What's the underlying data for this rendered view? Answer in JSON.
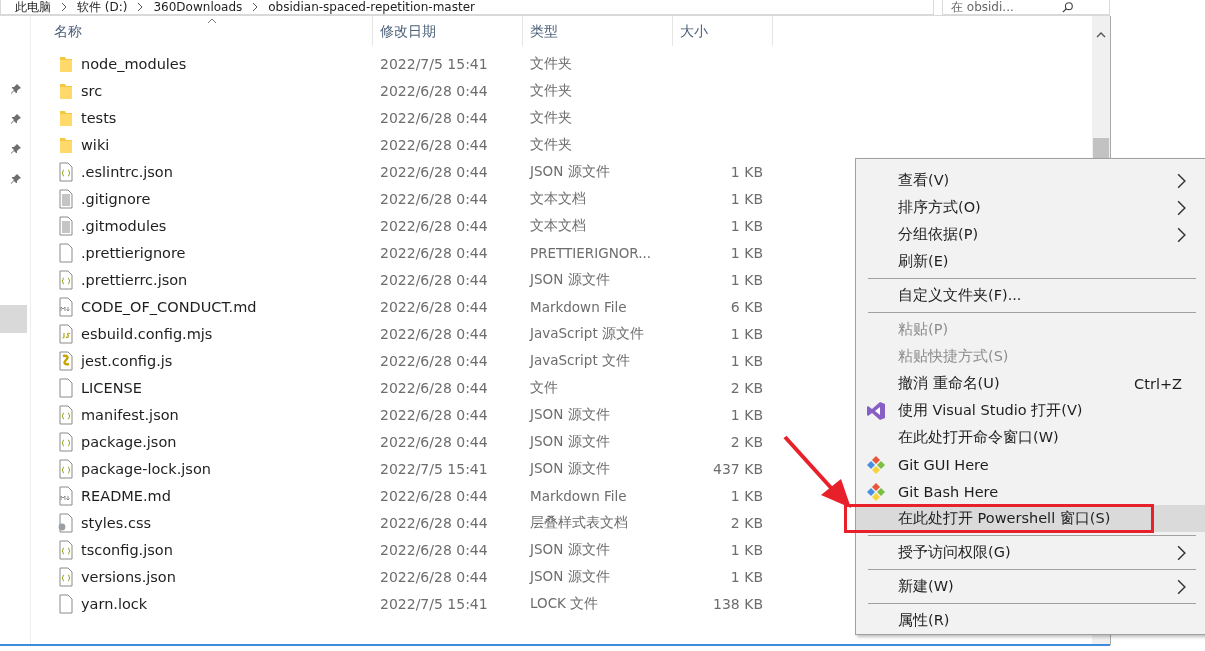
{
  "address": {
    "crumbs": [
      "此电脑",
      "软件 (D:)",
      "360Downloads",
      "obsidian-spaced-repetition-master"
    ]
  },
  "search": {
    "placeholder": "在 obsidi..."
  },
  "columns": [
    {
      "label": "名称",
      "sorted": true
    },
    {
      "label": "修改日期",
      "sorted": false
    },
    {
      "label": "类型",
      "sorted": false
    },
    {
      "label": "大小",
      "sorted": false
    }
  ],
  "rows": [
    {
      "kind": "folder",
      "name": "node_modules",
      "date": "2022/7/5 15:41",
      "type": "文件夹",
      "size": ""
    },
    {
      "kind": "folder",
      "name": "src",
      "date": "2022/6/28 0:44",
      "type": "文件夹",
      "size": ""
    },
    {
      "kind": "folder",
      "name": "tests",
      "date": "2022/6/28 0:44",
      "type": "文件夹",
      "size": ""
    },
    {
      "kind": "folder",
      "name": "wiki",
      "date": "2022/6/28 0:44",
      "type": "文件夹",
      "size": ""
    },
    {
      "kind": "json",
      "name": ".eslintrc.json",
      "date": "2022/6/28 0:44",
      "type": "JSON 源文件",
      "size": "1 KB"
    },
    {
      "kind": "text",
      "name": ".gitignore",
      "date": "2022/6/28 0:44",
      "type": "文本文档",
      "size": "1 KB"
    },
    {
      "kind": "text",
      "name": ".gitmodules",
      "date": "2022/6/28 0:44",
      "type": "文本文档",
      "size": "1 KB"
    },
    {
      "kind": "blank",
      "name": ".prettierignore",
      "date": "2022/6/28 0:44",
      "type": "PRETTIERIGNOR...",
      "size": "1 KB"
    },
    {
      "kind": "json",
      "name": ".prettierrc.json",
      "date": "2022/6/28 0:44",
      "type": "JSON 源文件",
      "size": "1 KB"
    },
    {
      "kind": "md",
      "name": "CODE_OF_CONDUCT.md",
      "date": "2022/6/28 0:44",
      "type": "Markdown File",
      "size": "6 KB"
    },
    {
      "kind": "js",
      "name": "esbuild.config.mjs",
      "date": "2022/6/28 0:44",
      "type": "JavaScript 源文件",
      "size": "1 KB"
    },
    {
      "kind": "script",
      "name": "jest.config.js",
      "date": "2022/6/28 0:44",
      "type": "JavaScript 文件",
      "size": "1 KB"
    },
    {
      "kind": "blank",
      "name": "LICENSE",
      "date": "2022/6/28 0:44",
      "type": "文件",
      "size": "2 KB"
    },
    {
      "kind": "json",
      "name": "manifest.json",
      "date": "2022/6/28 0:44",
      "type": "JSON 源文件",
      "size": "1 KB"
    },
    {
      "kind": "json",
      "name": "package.json",
      "date": "2022/6/28 0:44",
      "type": "JSON 源文件",
      "size": "2 KB"
    },
    {
      "kind": "json",
      "name": "package-lock.json",
      "date": "2022/7/5 15:41",
      "type": "JSON 源文件",
      "size": "437 KB"
    },
    {
      "kind": "md",
      "name": "README.md",
      "date": "2022/6/28 0:44",
      "type": "Markdown File",
      "size": "1 KB"
    },
    {
      "kind": "css",
      "name": "styles.css",
      "date": "2022/6/28 0:44",
      "type": "层叠样式表文档",
      "size": "2 KB"
    },
    {
      "kind": "json",
      "name": "tsconfig.json",
      "date": "2022/6/28 0:44",
      "type": "JSON 源文件",
      "size": "1 KB"
    },
    {
      "kind": "json",
      "name": "versions.json",
      "date": "2022/6/28 0:44",
      "type": "JSON 源文件",
      "size": "1 KB"
    },
    {
      "kind": "blank",
      "name": "yarn.lock",
      "date": "2022/7/5 15:41",
      "type": "LOCK 文件",
      "size": "138 KB"
    }
  ],
  "context_menu": [
    {
      "kind": "item",
      "label": "查看(V)",
      "submenu": true,
      "disabled": false,
      "selected": false
    },
    {
      "kind": "item",
      "label": "排序方式(O)",
      "submenu": true,
      "disabled": false,
      "selected": false
    },
    {
      "kind": "item",
      "label": "分组依据(P)",
      "submenu": true,
      "disabled": false,
      "selected": false
    },
    {
      "kind": "item",
      "label": "刷新(E)",
      "submenu": false,
      "disabled": false,
      "selected": false
    },
    {
      "kind": "separator"
    },
    {
      "kind": "item",
      "label": "自定义文件夹(F)...",
      "submenu": false,
      "disabled": false,
      "selected": false
    },
    {
      "kind": "separator"
    },
    {
      "kind": "item",
      "label": "粘贴(P)",
      "submenu": false,
      "disabled": true,
      "selected": false
    },
    {
      "kind": "item",
      "label": "粘贴快捷方式(S)",
      "submenu": false,
      "disabled": true,
      "selected": false
    },
    {
      "kind": "item",
      "label": "撤消 重命名(U)",
      "shortcut": "Ctrl+Z",
      "submenu": false,
      "disabled": false,
      "selected": false
    },
    {
      "kind": "vs",
      "label": "使用 Visual Studio 打开(V)",
      "submenu": false,
      "disabled": false,
      "selected": false
    },
    {
      "kind": "item",
      "label": "在此处打开命令窗口(W)",
      "submenu": false,
      "disabled": false,
      "selected": false
    },
    {
      "kind": "git",
      "label": "Git GUI Here",
      "submenu": false,
      "disabled": false,
      "selected": false
    },
    {
      "kind": "git",
      "label": "Git Bash Here",
      "submenu": false,
      "disabled": false,
      "selected": false
    },
    {
      "kind": "item",
      "label": "在此处打开 Powershell 窗口(S)",
      "submenu": false,
      "disabled": false,
      "selected": true
    },
    {
      "kind": "separator"
    },
    {
      "kind": "item",
      "label": "授予访问权限(G)",
      "submenu": true,
      "disabled": false,
      "selected": false
    },
    {
      "kind": "separator"
    },
    {
      "kind": "item",
      "label": "新建(W)",
      "submenu": true,
      "disabled": false,
      "selected": false
    },
    {
      "kind": "separator"
    },
    {
      "kind": "item",
      "label": "属性(R)",
      "submenu": false,
      "disabled": false,
      "selected": false
    }
  ]
}
